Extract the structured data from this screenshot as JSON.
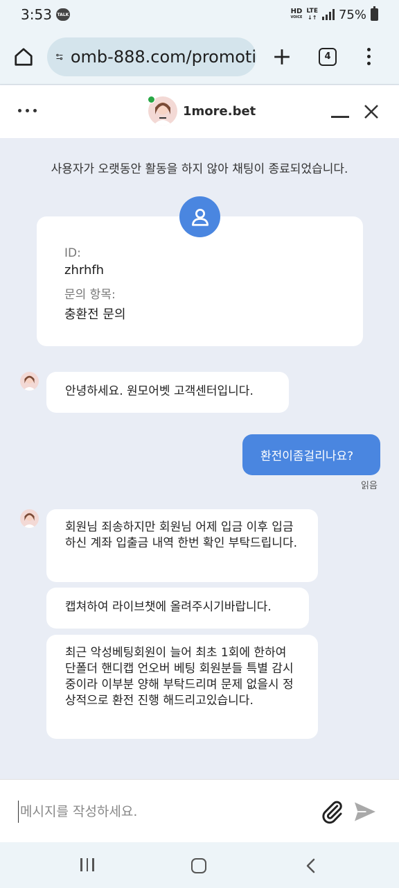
{
  "status_bar": {
    "time": "3:53",
    "talk_badge": "TALK",
    "hd_label": "HD",
    "voice_label": "VOICE",
    "lte_label": "LTE",
    "battery": "75%"
  },
  "browser": {
    "url": "omb-888.com/promoti",
    "tab_count": "4"
  },
  "chat_header": {
    "title": "1more.bet"
  },
  "chat": {
    "notice": "사용자가 오랫동안 활동을 하지 않아 채팅이 종료되었습니다.",
    "info_card": {
      "id_label": "ID:",
      "id_value": "zhrhfh",
      "topic_label": "문의 항목:",
      "topic_value": "충환전 문의"
    },
    "messages": [
      {
        "from": "agent",
        "text": "안녕하세요. 원모어벳 고객센터입니다."
      },
      {
        "from": "user",
        "text": "환전이좀걸리나요?",
        "status": "읽음"
      },
      {
        "from": "agent",
        "text": "회원님 죄송하지만 회원님 어제 입금 이후 입금하신 계좌 입출금 내역 한번 확인 부탁드립니다."
      },
      {
        "from": "agent",
        "text": "캡쳐하여 라이브챗에 올려주시기바랍니다."
      },
      {
        "from": "agent",
        "text": "최근 악성베팅회원이 늘어 최초 1회에 한하여 단폴더 핸디캡 언오버 베팅 회원분들 특별 감시 중이라 이부분 양해 부탁드리며 문제 없을시 정상적으로 환전 진행 해드리고있습니다."
      }
    ]
  },
  "composer": {
    "placeholder": "메시지를 작성하세요."
  },
  "colors": {
    "accent": "#4a86e0",
    "chat_bg": "#e9edf5",
    "online": "#28a745"
  }
}
